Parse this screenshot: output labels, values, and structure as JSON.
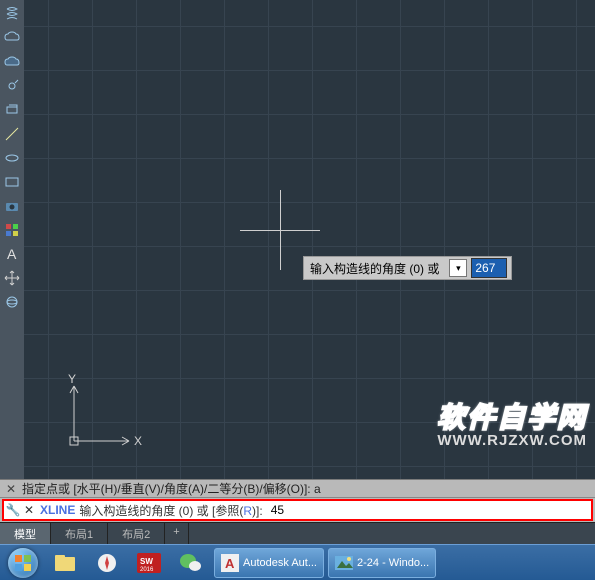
{
  "toolbar": {
    "icons": [
      "helix",
      "cloud",
      "cloud2",
      "revision",
      "layer",
      "line",
      "circle",
      "arc",
      "rectangle",
      "camera",
      "palette",
      "text",
      "move",
      "orbit"
    ]
  },
  "canvas": {
    "ucs": {
      "x_label": "X",
      "y_label": "Y"
    },
    "tooltip": {
      "text": "输入构造线的角度 (0) 或",
      "icon": "▾",
      "value": "267"
    },
    "watermark": {
      "line1": "软件自学网",
      "line2": "WWW.RJZXW.COM"
    }
  },
  "command": {
    "close": "✕",
    "history": "指定点或 [水平(H)/垂直(V)/角度(A)/二等分(B)/偏移(O)]: a",
    "cmd_name": "XLINE",
    "prompt_pre": "输入构造线的角度 (0) 或 [参照(",
    "prompt_ref": "R",
    "prompt_post": ")]:",
    "value": "45"
  },
  "tabs": {
    "model": "模型",
    "layout1": "布局1",
    "layout2": "布局2",
    "plus": "+"
  },
  "taskbar": {
    "items": [
      {
        "label": "Autodesk Aut...",
        "icon": "A",
        "color": "#d23c3c"
      },
      {
        "label": "2-24 - Windo...",
        "icon": "▭",
        "color": "#5bb0e8"
      }
    ]
  }
}
